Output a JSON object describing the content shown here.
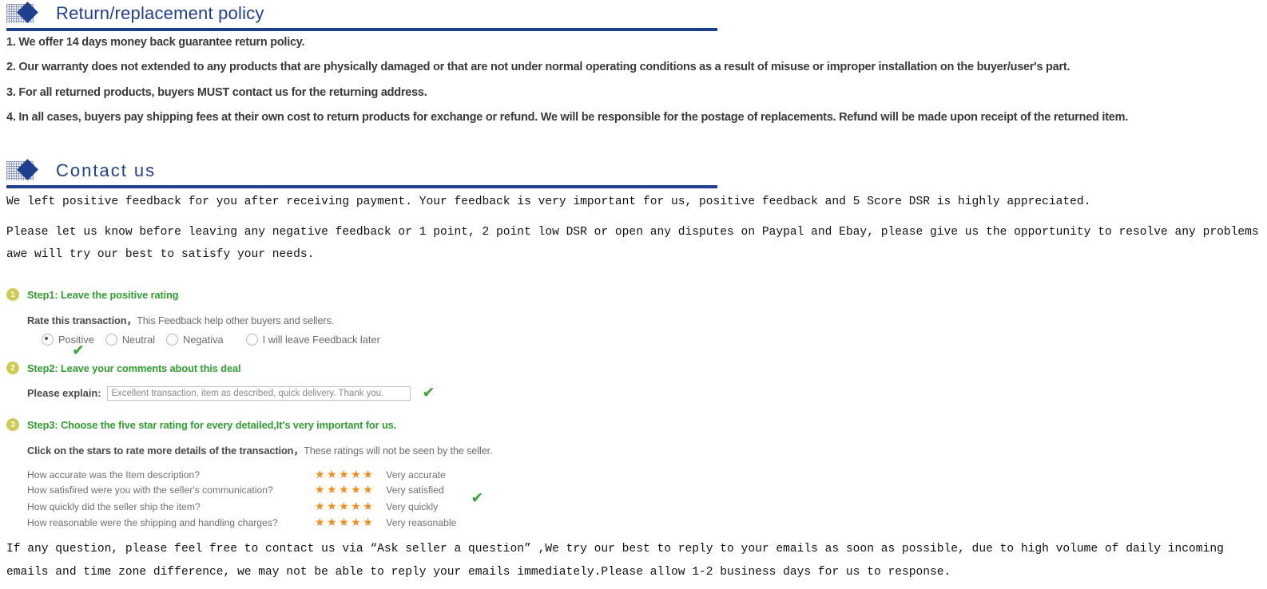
{
  "sections": {
    "return_policy": {
      "heading": "Return/replacement policy",
      "icon": "blue-diamond-grid-icon",
      "items": [
        "1. We offer 14 days money back guarantee return policy.",
        "2. Our warranty does not extended to any products that are physically damaged or that are not under normal operating conditions as a result of misuse or improper installation on the buyer/user's part.",
        "3. For all returned products, buyers MUST contact us for the returning address.",
        "4. In all cases, buyers pay shipping fees at their own cost to return products for exchange or refund. We will be responsible for the postage of replacements. Refund will be made upon receipt of the returned item."
      ]
    },
    "contact_us": {
      "heading": "Contact us",
      "icon": "blue-diamond-grid-icon",
      "paragraph1": "We left positive feedback for you after receiving payment. Your feedback is very important for us, positive feedback and 5 Score DSR is highly appreciated.",
      "paragraph2": "Please let us know before leaving any negative feedback or 1 point, 2 point low DSR or open any disputes on Paypal and Ebay, please give us the opportunity to resolve any problems awe will try our best to satisfy your needs.",
      "closing": "If any question, please feel free to contact us via “Ask seller a question” ,We try our best to reply to your emails as soon as possible, due to high volume of daily incoming emails and time zone difference, we may not be able to reply your emails immediately.Please allow 1-2 business days for us to response."
    }
  },
  "steps": {
    "step1": {
      "badge": "1",
      "title": "Step1: Leave the positive rating",
      "rate_bold": "Rate this transaction，",
      "rate_rest": "This Feedback help other buyers and sellers.",
      "options": [
        {
          "label": "Positive",
          "selected": true
        },
        {
          "label": "Neutral",
          "selected": false
        },
        {
          "label": "Negativa",
          "selected": false
        },
        {
          "label": "I will leave Feedback later",
          "selected": false
        }
      ],
      "check_mark": "✔"
    },
    "step2": {
      "badge": "2",
      "title": "Step2: Leave your comments about this deal",
      "explain_label": "Please explain:",
      "explain_value": "Excellent transaction, item as described, quick delivery. Thank you.",
      "check_mark": "✔"
    },
    "step3": {
      "badge": "3",
      "title": "Step3: Choose the five star rating for every detailed,It's very important for us.",
      "click_bold": "Click on the stars to rate more details of the transaction，",
      "click_rest": "These ratings will not be seen by the seller.",
      "check_mark": "✔",
      "stars_glyph": "★★★★★",
      "rows": [
        {
          "question": "How accurate was the Item description?",
          "stars": 5,
          "label": "Very accurate"
        },
        {
          "question": "How satisfired were you with the seller's communication?",
          "stars": 5,
          "label": "Very satisfied"
        },
        {
          "question": "How quickly did the seller ship the item?",
          "stars": 5,
          "label": "Very quickly"
        },
        {
          "question": "How reasonable were the shipping and handling charges?",
          "stars": 5,
          "label": "Very reasonable"
        }
      ]
    }
  },
  "colors": {
    "heading_blue": "#1f3f8f",
    "step_green": "#2f9e2f",
    "badge_olive": "#cdcb52",
    "star_orange": "#f28c1c",
    "check_green": "#3aa63a"
  }
}
